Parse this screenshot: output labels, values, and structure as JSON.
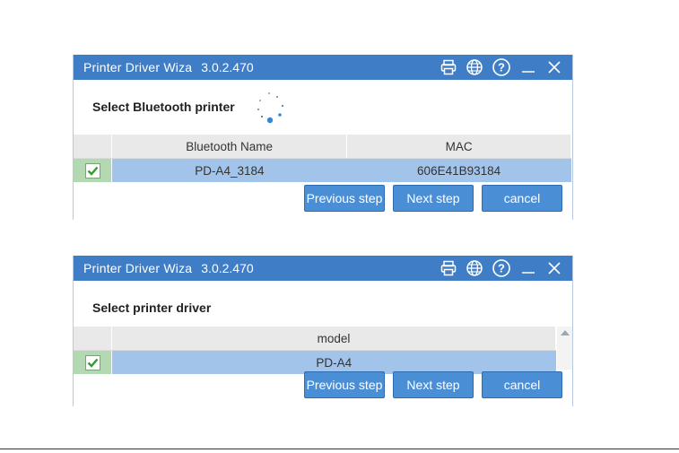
{
  "windows": [
    {
      "title": "Printer Driver Wiza",
      "version": "3.0.2.470",
      "heading": "Select Bluetooth printer",
      "columns": [
        "Bluetooth Name",
        "MAC"
      ],
      "rows": [
        {
          "checked": true,
          "cells": [
            "PD-A4_3184",
            "606E41B93184"
          ]
        }
      ],
      "buttons": {
        "previous": "Previous step",
        "next": "Next step",
        "cancel": "cancel"
      }
    },
    {
      "title": "Printer Driver Wiza",
      "version": "3.0.2.470",
      "heading": "Select printer driver",
      "columns": [
        "model"
      ],
      "rows": [
        {
          "checked": true,
          "cells": [
            "PD-A4"
          ]
        }
      ],
      "buttons": {
        "previous": "Previous step",
        "next": "Next step",
        "cancel": "cancel"
      }
    }
  ],
  "titlebar_icons": [
    "printer-icon",
    "globe-icon",
    "help-icon",
    "minimize-icon",
    "close-icon"
  ],
  "colors": {
    "titlebar": "#3f7ec6",
    "selected_row": "#a2c3ea",
    "button": "#4a8fd6",
    "check": "#2e9e2e"
  }
}
